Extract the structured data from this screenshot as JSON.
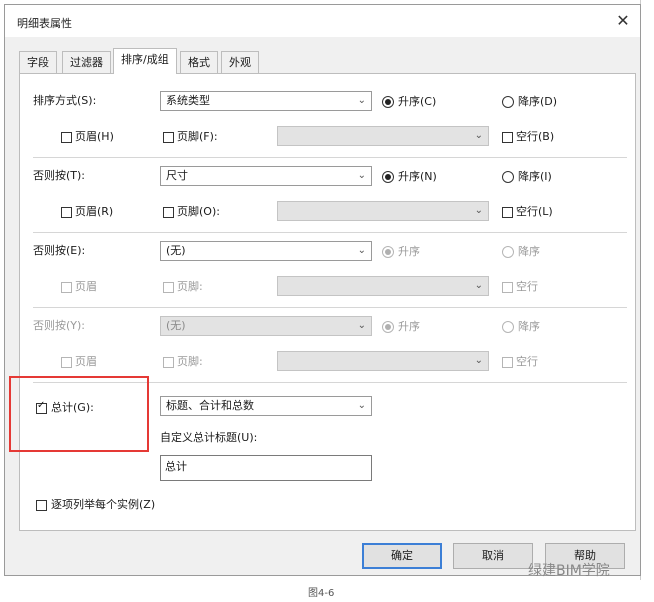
{
  "window": {
    "title": "明细表属性",
    "close": "✕"
  },
  "tabs": [
    "字段",
    "过滤器",
    "排序/成组",
    "格式",
    "外观"
  ],
  "groups": [
    {
      "label": "排序方式(S):",
      "value": "系统类型",
      "asc": "升序(C)",
      "desc": "降序(D)",
      "header": "页眉(H)",
      "footer": "页脚(F):",
      "blank": "空行(B)",
      "enabled": true
    },
    {
      "label": "否则按(T):",
      "value": "尺寸",
      "asc": "升序(N)",
      "desc": "降序(I)",
      "header": "页眉(R)",
      "footer": "页脚(O):",
      "blank": "空行(L)",
      "enabled": true
    },
    {
      "label": "否则按(E):",
      "value": "(无)",
      "asc": "升序",
      "desc": "降序",
      "header": "页眉",
      "footer": "页脚:",
      "blank": "空行",
      "enabled": true
    },
    {
      "label": "否则按(Y):",
      "value": "(无)",
      "asc": "升序",
      "desc": "降序",
      "header": "页眉",
      "footer": "页脚:",
      "blank": "空行",
      "enabled": false
    }
  ],
  "totals": {
    "label": "总计(G):",
    "value": "标题、合计和总数",
    "custom_label": "自定义总计标题(U):",
    "custom_value": "总计"
  },
  "itemize": "逐项列举每个实例(Z)",
  "buttons": {
    "ok": "确定",
    "cancel": "取消",
    "help": "帮助"
  },
  "caption": "图4-6",
  "watermark": "绿建BIM学院"
}
